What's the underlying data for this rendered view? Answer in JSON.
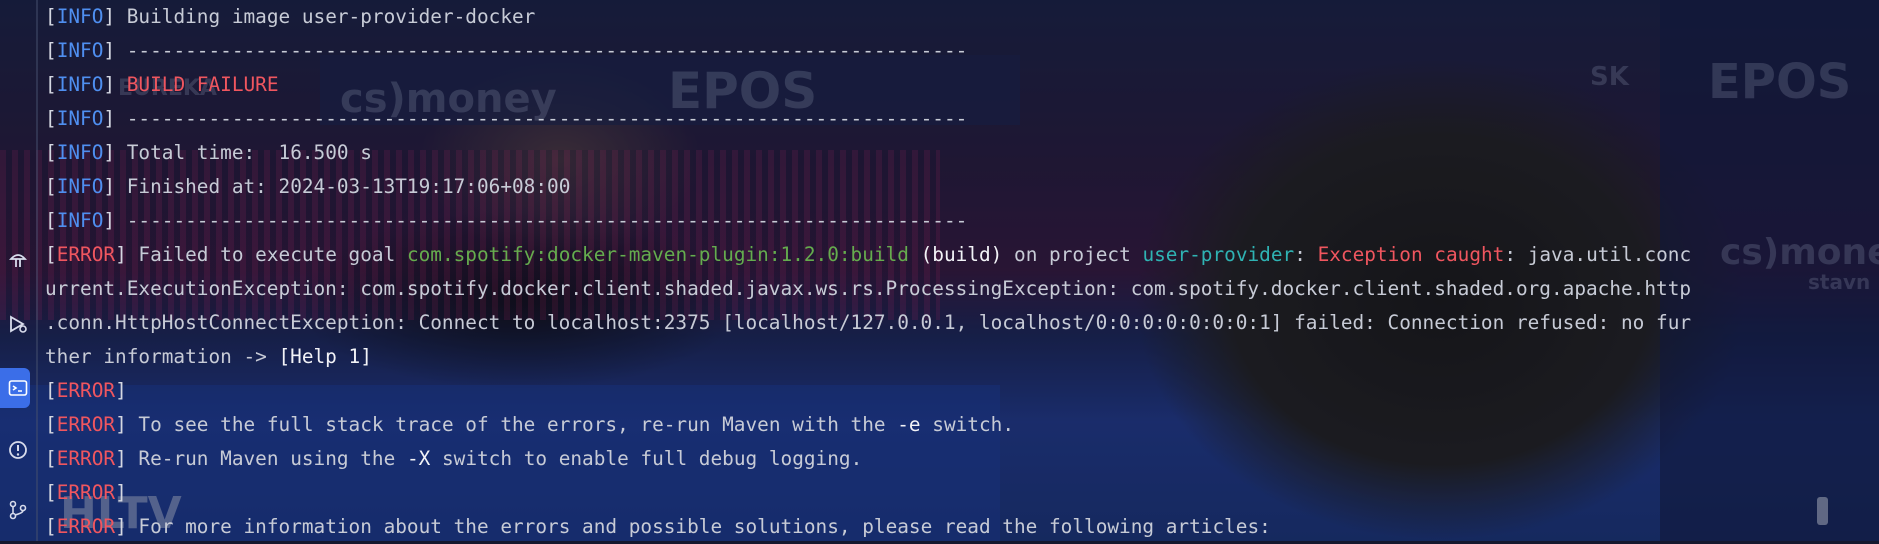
{
  "background": {
    "logos": [
      "EUREKA",
      "cs)money",
      "EPOS",
      "EPOS",
      "cs)money",
      "HLTV",
      "SK",
      "stavn"
    ]
  },
  "sidebar": {
    "tools": [
      {
        "icon": "mushroom-icon"
      },
      {
        "icon": "play-services-icon"
      },
      {
        "icon": "terminal-icon"
      },
      {
        "icon": "problems-icon"
      },
      {
        "icon": "git-branch-icon"
      }
    ],
    "active_tool": "terminal-icon"
  },
  "console": {
    "lines": {
      "l1": {
        "tag": "INFO",
        "text": " Building image user-provider-docker"
      },
      "l2": {
        "tag": "INFO",
        "text": " ------------------------------------------------------------------------"
      },
      "l3": {
        "tag": "INFO",
        "text": "BUILD FAILURE"
      },
      "l4": {
        "tag": "INFO",
        "text": " ------------------------------------------------------------------------"
      },
      "l5": {
        "tag": "INFO",
        "text": " Total time:  16.500 s"
      },
      "l6": {
        "tag": "INFO",
        "text": " Finished at: 2024-03-13T19:17:06+08:00"
      },
      "l7": {
        "tag": "INFO",
        "text": " ------------------------------------------------------------------------"
      },
      "l8": {
        "tag": "ERROR",
        "p1": " Failed to execute goal ",
        "plugin": "com.spotify:docker-maven-plugin:1.2.0:build",
        "p2": " (build)",
        "p3": " on project ",
        "project": "user-provider",
        "p4": ": ",
        "exc": "Exception caught",
        "p5": ": java.util.conc"
      },
      "l9": {
        "text": "urrent.ExecutionException: com.spotify.docker.client.shaded.javax.ws.rs.ProcessingException: com.spotify.docker.client.shaded.org.apache.http"
      },
      "l10": {
        "text": ".conn.HttpHostConnectException: Connect to localhost:2375 [localhost/127.0.0.1, localhost/0:0:0:0:0:0:0:1] failed: Connection refused: no fur"
      },
      "l11": {
        "text": "ther information -> ",
        "help": "[Help 1]"
      },
      "l12": {
        "tag": "ERROR"
      },
      "l13": {
        "tag": "ERROR",
        "p1": " To see the full stack trace of the errors, re-run Maven with the ",
        "flag": "-e",
        "p2": " switch."
      },
      "l14": {
        "tag": "ERROR",
        "p1": " Re-run Maven using the ",
        "flag": "-X",
        "p2": " switch to enable full debug logging."
      },
      "l15": {
        "tag": "ERROR"
      },
      "l16": {
        "tag": "ERROR",
        "text": " For more information about the errors and possible solutions, please read the following articles:"
      }
    }
  },
  "colors": {
    "info_tag": "#4f8ff0",
    "error_tag": "#f0565f",
    "plugin": "#65ac4e",
    "project": "#2fb3b3",
    "text": "#c7cbd6"
  }
}
